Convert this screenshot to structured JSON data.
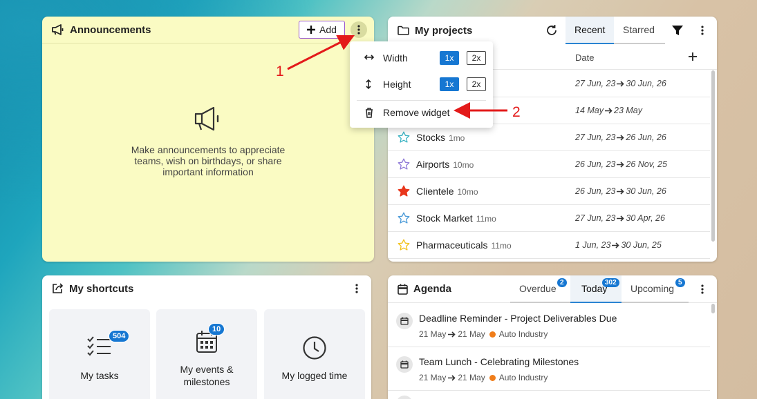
{
  "announcements": {
    "title": "Announcements",
    "add_label": "Add",
    "empty_text": "Make announcements to appreciate teams, wish on birthdays, or share important information",
    "bg_color": "#fafbc3"
  },
  "widget_menu": {
    "width_label": "Width",
    "height_label": "Height",
    "size_1x": "1x",
    "size_2x": "2x",
    "remove_label": "Remove widget"
  },
  "projects": {
    "title": "My projects",
    "tabs": [
      "Recent",
      "Starred"
    ],
    "active_tab": "Recent",
    "date_column": "Date",
    "rows": [
      {
        "name": "",
        "age": "",
        "start": "27 Jun, 23",
        "end": "30 Jun, 26",
        "star": "none"
      },
      {
        "name": "",
        "age": "",
        "start": "14 May",
        "end": "23 May",
        "star": "none"
      },
      {
        "name": "Stocks",
        "age": "1mo",
        "start": "27 Jun, 23",
        "end": "26 Jun, 26",
        "star": "outline-teal"
      },
      {
        "name": "Airports",
        "age": "10mo",
        "start": "26 Jun, 23",
        "end": "26 Nov, 25",
        "star": "outline-purple"
      },
      {
        "name": "Clientele",
        "age": "10mo",
        "start": "26 Jun, 23",
        "end": "30 Jun, 26",
        "star": "filled-red"
      },
      {
        "name": "Stock Market",
        "age": "11mo",
        "start": "27 Jun, 23",
        "end": "30 Apr, 26",
        "star": "outline-blue"
      },
      {
        "name": "Pharmaceuticals",
        "age": "11mo",
        "start": "1 Jun, 23",
        "end": "30 Jun, 25",
        "star": "outline-yellow"
      }
    ]
  },
  "shortcuts": {
    "title": "My shortcuts",
    "tiles": [
      {
        "label": "My tasks",
        "badge": "504",
        "icon": "checklist-icon"
      },
      {
        "label": "My events & milestones",
        "badge": "10",
        "icon": "calendar-icon"
      },
      {
        "label": "My logged time",
        "badge": "",
        "icon": "clock-icon"
      }
    ]
  },
  "agenda": {
    "title": "Agenda",
    "tabs": [
      {
        "label": "Overdue",
        "count": "2"
      },
      {
        "label": "Today",
        "count": "302"
      },
      {
        "label": "Upcoming",
        "count": "5"
      }
    ],
    "active_tab": "Today",
    "items": [
      {
        "title": "Deadline Reminder - Project Deliverables Due",
        "from": "21 May",
        "to": "21 May",
        "project": "Auto Industry"
      },
      {
        "title": "Team Lunch - Celebrating Milestones",
        "from": "21 May",
        "to": "21 May",
        "project": "Auto Industry"
      }
    ]
  },
  "annotations": {
    "step1": "1",
    "step2": "2"
  },
  "colors": {
    "accent": "#1677d2",
    "annotation": "#e31a1a",
    "project_dot": "#f07d1a"
  }
}
